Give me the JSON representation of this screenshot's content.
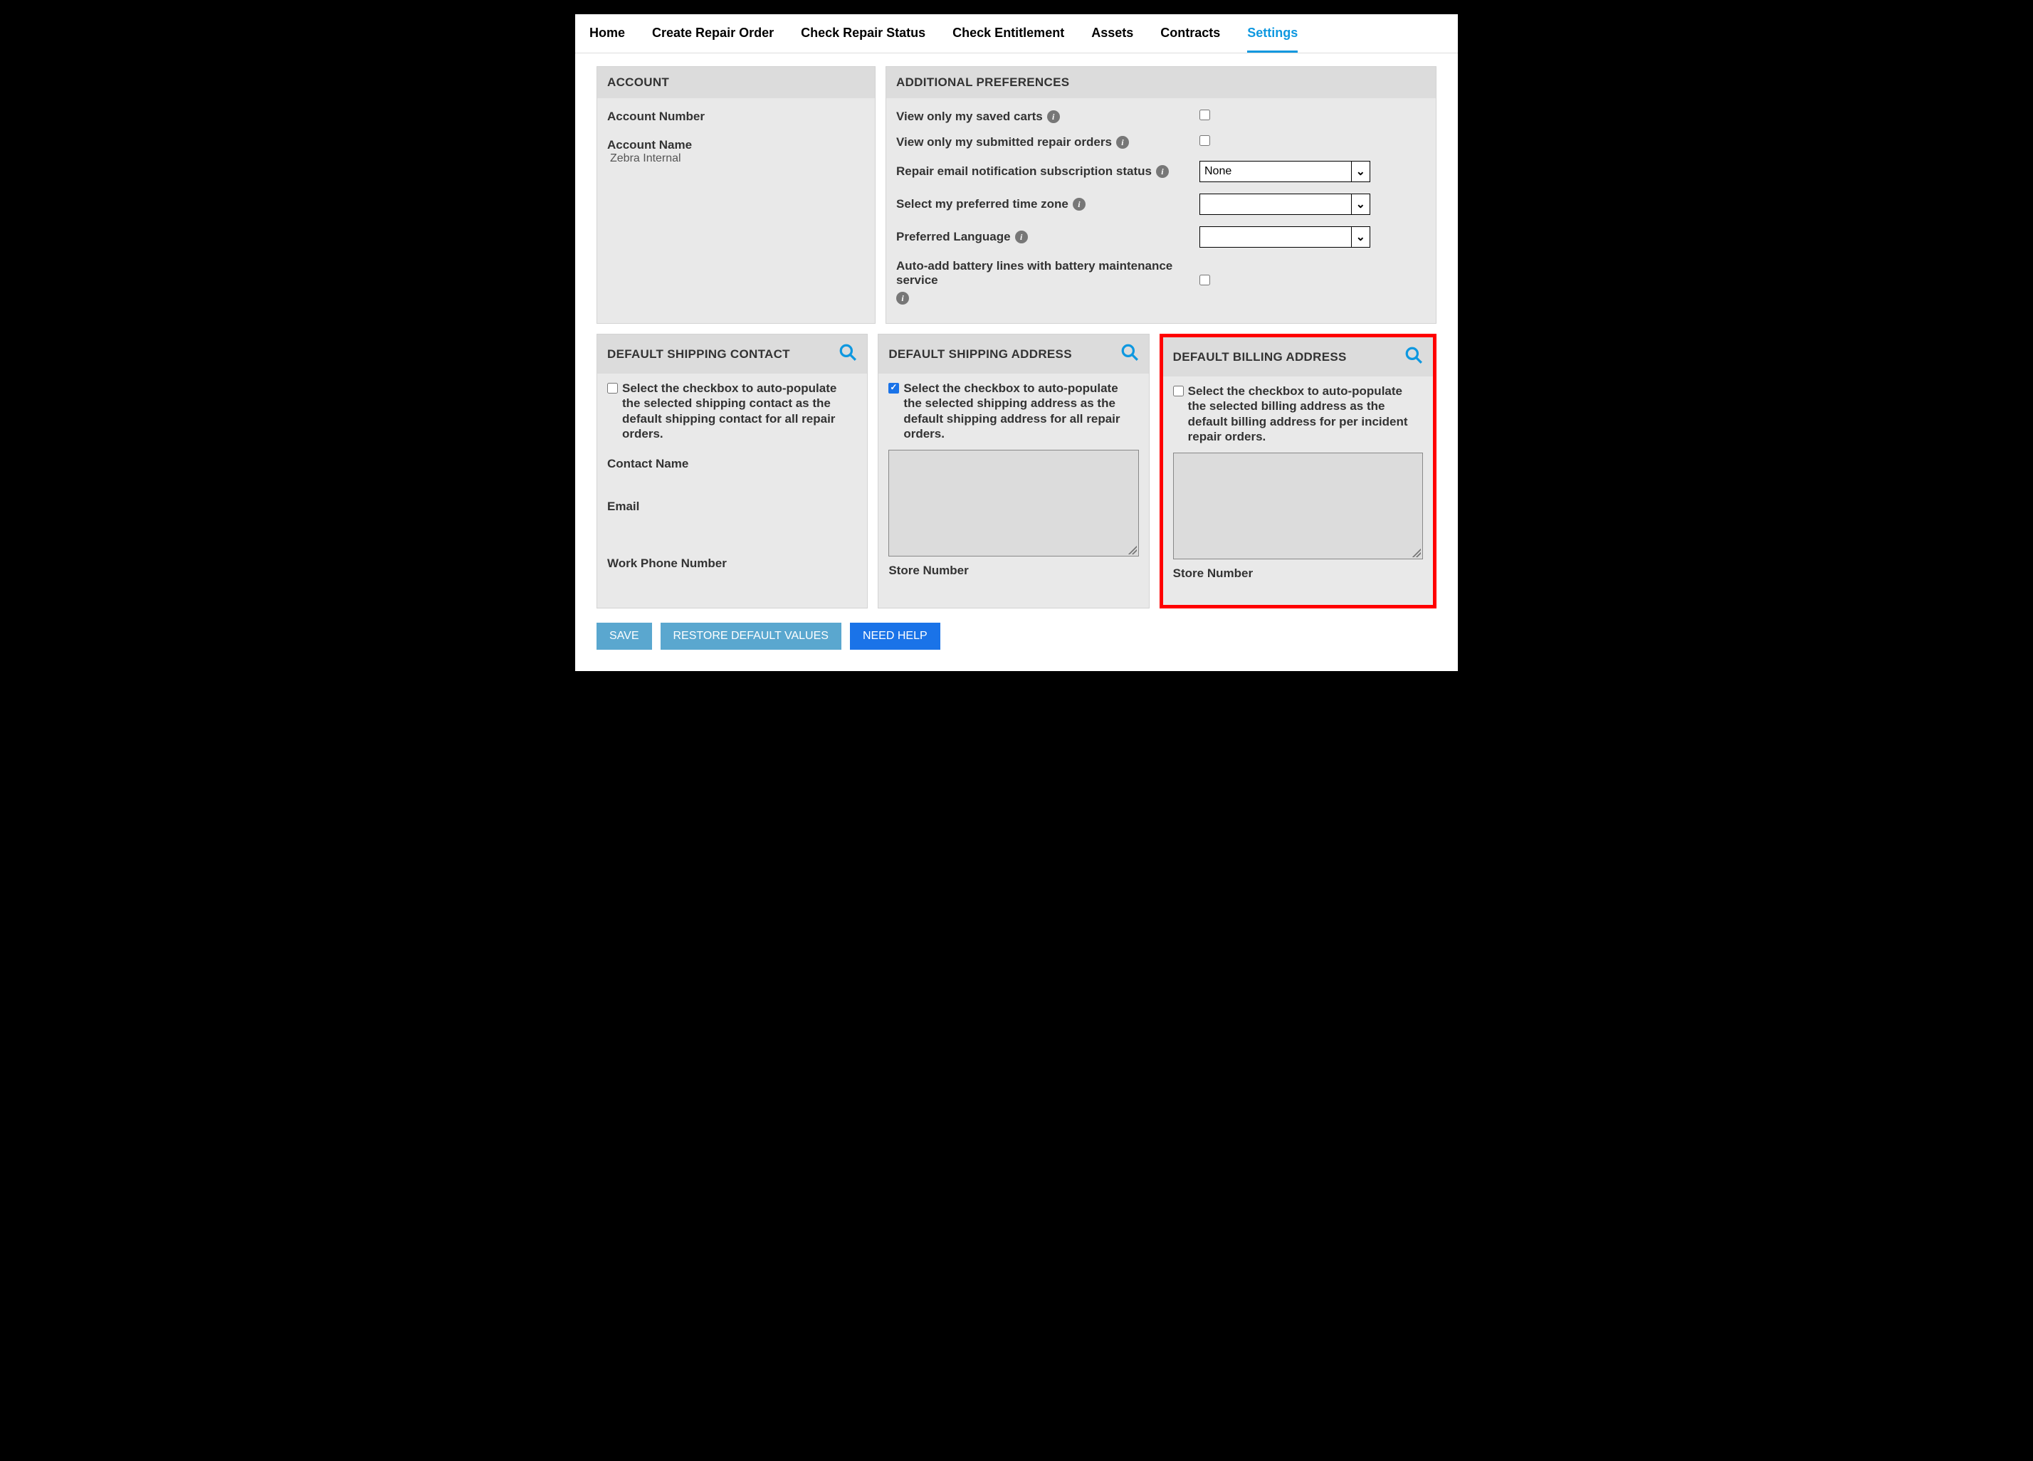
{
  "tabs": {
    "home": "Home",
    "create": "Create Repair Order",
    "status": "Check Repair Status",
    "entitlement": "Check Entitlement",
    "assets": "Assets",
    "contracts": "Contracts",
    "settings": "Settings"
  },
  "account": {
    "header": "ACCOUNT",
    "number_label": "Account Number",
    "number_value": "",
    "name_label": "Account Name",
    "name_value": "Zebra Internal"
  },
  "prefs": {
    "header": "ADDITIONAL PREFERENCES",
    "saved_carts": "View only my saved carts",
    "submitted_orders": "View only my submitted repair orders",
    "email_sub": "Repair email notification subscription status",
    "email_sub_value": "None",
    "timezone": "Select my preferred time zone",
    "timezone_value": "",
    "language": "Preferred Language",
    "language_value": "",
    "auto_battery": "Auto-add battery lines with battery maintenance service"
  },
  "ship_contact": {
    "header": "DEFAULT SHIPPING CONTACT",
    "auto_text": "Select the checkbox to auto-populate the selected shipping contact as the default shipping contact for all repair orders.",
    "contact_name": "Contact Name",
    "email": "Email",
    "phone": "Work Phone Number"
  },
  "ship_address": {
    "header": "DEFAULT SHIPPING ADDRESS",
    "auto_text": "Select the checkbox to auto-populate the selected shipping address as the default shipping address for all repair orders.",
    "store": "Store Number"
  },
  "bill_address": {
    "header": "DEFAULT BILLING ADDRESS",
    "auto_text": "Select the checkbox to auto-populate the selected billing address as the default billing address for per incident repair orders.",
    "store": "Store Number"
  },
  "buttons": {
    "save": "SAVE",
    "restore": "RESTORE DEFAULT VALUES",
    "help": "NEED HELP"
  }
}
